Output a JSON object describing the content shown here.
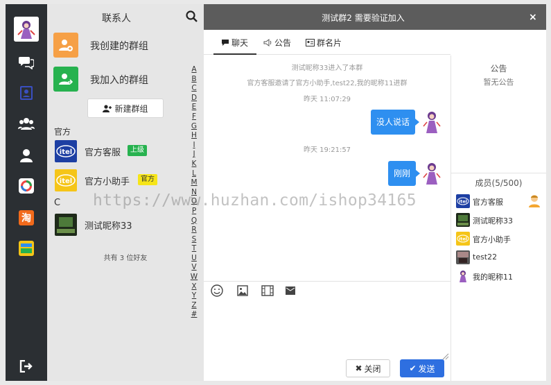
{
  "sidebar": {
    "icons": [
      "user-avatar",
      "chat-bubbles-icon",
      "contacts-book-icon",
      "group-people-icon",
      "single-user-icon",
      "app-circle-icon",
      "taobao-icon",
      "cards-icon",
      "logout-icon"
    ]
  },
  "contacts": {
    "title": "联系人",
    "groups": [
      {
        "label": "我创建的群组",
        "color": "#f6a046"
      },
      {
        "label": "我加入的群组",
        "color": "#27b24f"
      }
    ],
    "new_group_label": "新建群组",
    "section_official": "官方",
    "section_c": "C",
    "items": [
      {
        "name": "官方客服",
        "badge": "上级",
        "badge_color": "#27b24f",
        "badge_text_color": "#ffffff"
      },
      {
        "name": "官方小助手",
        "badge": "官方",
        "badge_color": "#f6e518",
        "badge_text_color": "#333333"
      },
      {
        "name": "测试昵称33",
        "badge": "",
        "badge_color": "",
        "badge_text_color": ""
      }
    ],
    "friends_count": "共有 3 位好友",
    "alphabet": [
      "A",
      "B",
      "C",
      "D",
      "E",
      "F",
      "G",
      "H",
      "I",
      "J",
      "K",
      "L",
      "M",
      "N",
      "O",
      "P",
      "Q",
      "R",
      "S",
      "T",
      "U",
      "V",
      "W",
      "X",
      "Y",
      "Z",
      "#"
    ]
  },
  "chat": {
    "title": "测试群2 需要验证加入",
    "close_glyph": "×",
    "tabs": [
      {
        "label": "聊天",
        "icon": "chat-icon"
      },
      {
        "label": "公告",
        "icon": "speaker-icon"
      },
      {
        "label": "群名片",
        "icon": "card-icon"
      }
    ],
    "system_messages": [
      "测试昵称33进入了本群",
      "官方客服邀请了官方小助手,test22,我的昵称11进群",
      "昨天 11:07:29",
      "昨天 19:21:57"
    ],
    "messages": [
      {
        "text": "没人说话"
      },
      {
        "text": "刚刚"
      }
    ],
    "toolbar": [
      "emoji-icon",
      "image-icon",
      "video-icon",
      "envelope-icon"
    ],
    "close_button": "关闭",
    "send_button": "发送"
  },
  "info": {
    "notice_title": "公告",
    "notice_body": "暂无公告",
    "members_title": "成员(5/500)",
    "members": [
      {
        "name": "官方客服",
        "owner": true
      },
      {
        "name": "测试昵称33",
        "owner": false
      },
      {
        "name": "官方小助手",
        "owner": false
      },
      {
        "name": "test22",
        "owner": false
      },
      {
        "name": "我的昵称11",
        "owner": false
      }
    ]
  },
  "watermark": "https://www.huzhan.com/ishop34165"
}
